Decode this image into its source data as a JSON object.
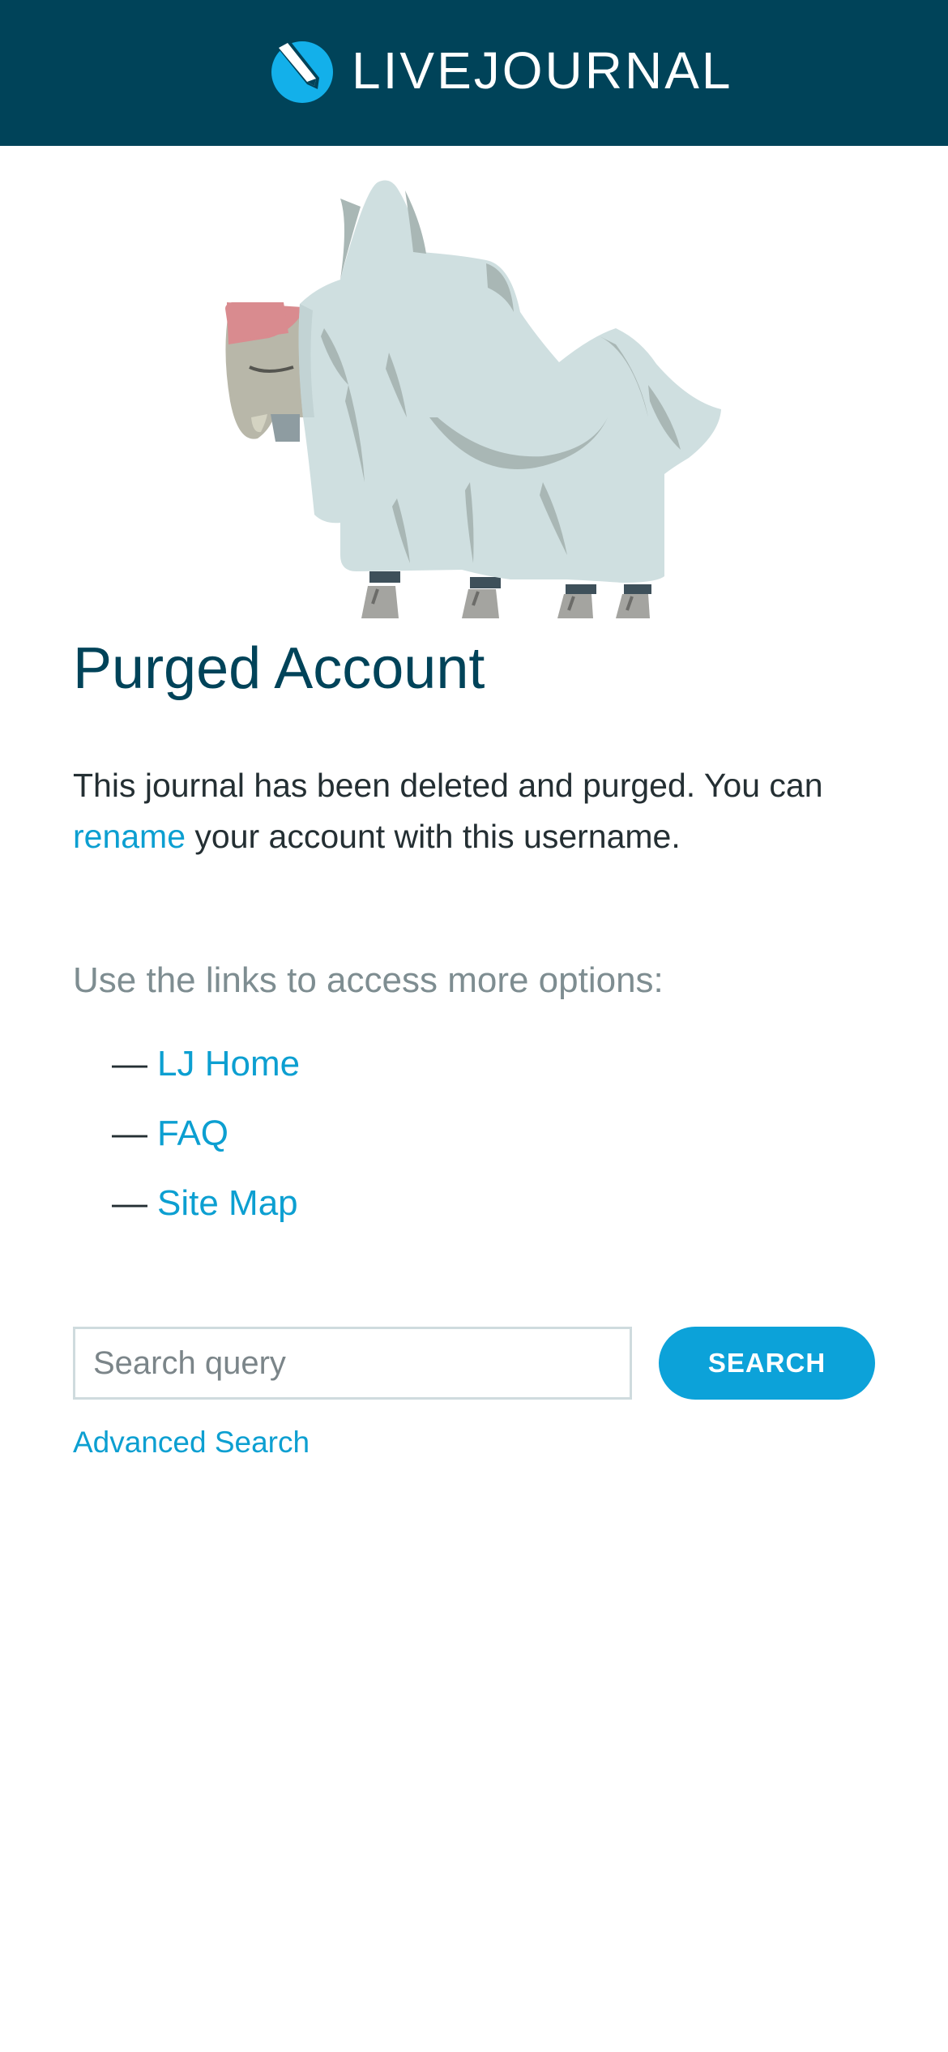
{
  "header": {
    "brand": "LIVEJOURNAL",
    "logo_icon": "livejournal-pencil-logo-icon"
  },
  "illustration": {
    "icon": "ghost-sheet-creature-illustration"
  },
  "main": {
    "title": "Purged Account",
    "message_before": "This journal has been deleted and purged. You can ",
    "rename_link": "rename",
    "message_after": " your account with this username.",
    "options_heading": "Use the links to access more options:",
    "dash": "—",
    "links": [
      {
        "label": "LJ Home"
      },
      {
        "label": "FAQ"
      },
      {
        "label": "Site Map"
      }
    ]
  },
  "search": {
    "placeholder": "Search query",
    "value": "",
    "button_label": "SEARCH",
    "advanced_label": "Advanced Search"
  },
  "colors": {
    "header_bg": "#004359",
    "title": "#004359",
    "link": "#0c9fd1",
    "button": "#0ca2d9",
    "muted": "#7e8d91"
  }
}
